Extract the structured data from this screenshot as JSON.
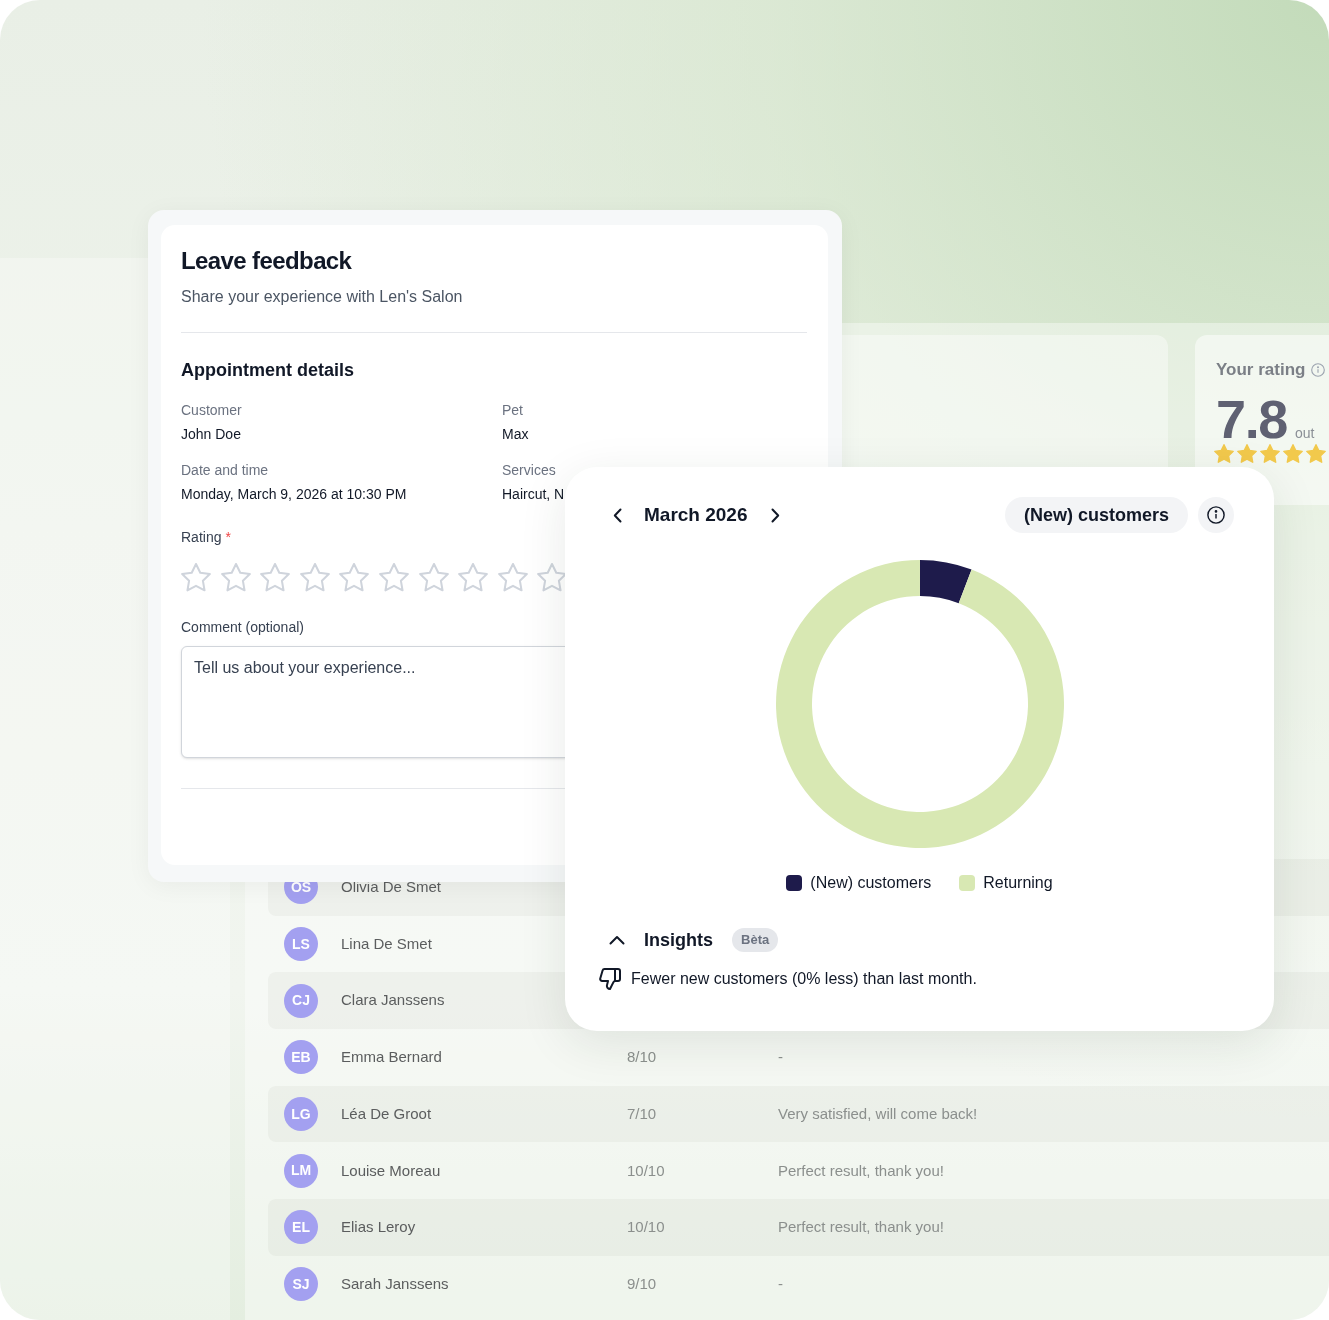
{
  "feedback_dialog": {
    "title": "Leave feedback",
    "subtitle": "Share your experience with Len's Salon",
    "section_title": "Appointment details",
    "details": [
      {
        "label": "Customer",
        "value": "John Doe"
      },
      {
        "label": "Pet",
        "value": "Max"
      },
      {
        "label": "Date and time",
        "value": "Monday, March 9, 2026 at 10:30 PM"
      },
      {
        "label": "Services",
        "value": "Haircut, N"
      }
    ],
    "rating": {
      "label": "Rating",
      "required_mark": "*",
      "stars": 0
    },
    "comment": {
      "label": "Comment (optional)",
      "placeholder": "Tell us about your experience..."
    }
  },
  "rating_card": {
    "title": "Your rating",
    "value": "7.8",
    "suffix": "out",
    "stars": 5
  },
  "customers_chart": {
    "month": "March 2026",
    "metric": "(New) customers",
    "legend": [
      {
        "label": "(New) customers",
        "color": "#1e1b4b"
      },
      {
        "label": "Returning",
        "color": "#d8e8b3"
      }
    ],
    "insights": {
      "title": "Insights",
      "badge": "Bèta",
      "expanded": true,
      "text": "Fewer new customers (0% less) than last month."
    }
  },
  "reviews_table": {
    "rows": [
      {
        "initials": "OS",
        "name": "Olivia De Smet"
      },
      {
        "initials": "LS",
        "name": "Lina De Smet"
      },
      {
        "initials": "CJ",
        "name": "Clara Janssens"
      },
      {
        "initials": "EB",
        "name": "Emma Bernard",
        "score": "8/10",
        "comment": "-"
      },
      {
        "initials": "LG",
        "name": "Léa De Groot",
        "score": "7/10",
        "comment": "Very satisfied, will come back!"
      },
      {
        "initials": "LM",
        "name": "Louise Moreau",
        "score": "10/10",
        "comment": "Perfect result, thank you!"
      },
      {
        "initials": "EL",
        "name": "Elias Leroy",
        "score": "10/10",
        "comment": "Perfect result, thank you!"
      },
      {
        "initials": "SJ",
        "name": "Sarah Janssens",
        "score": "9/10",
        "comment": "-"
      }
    ]
  }
}
